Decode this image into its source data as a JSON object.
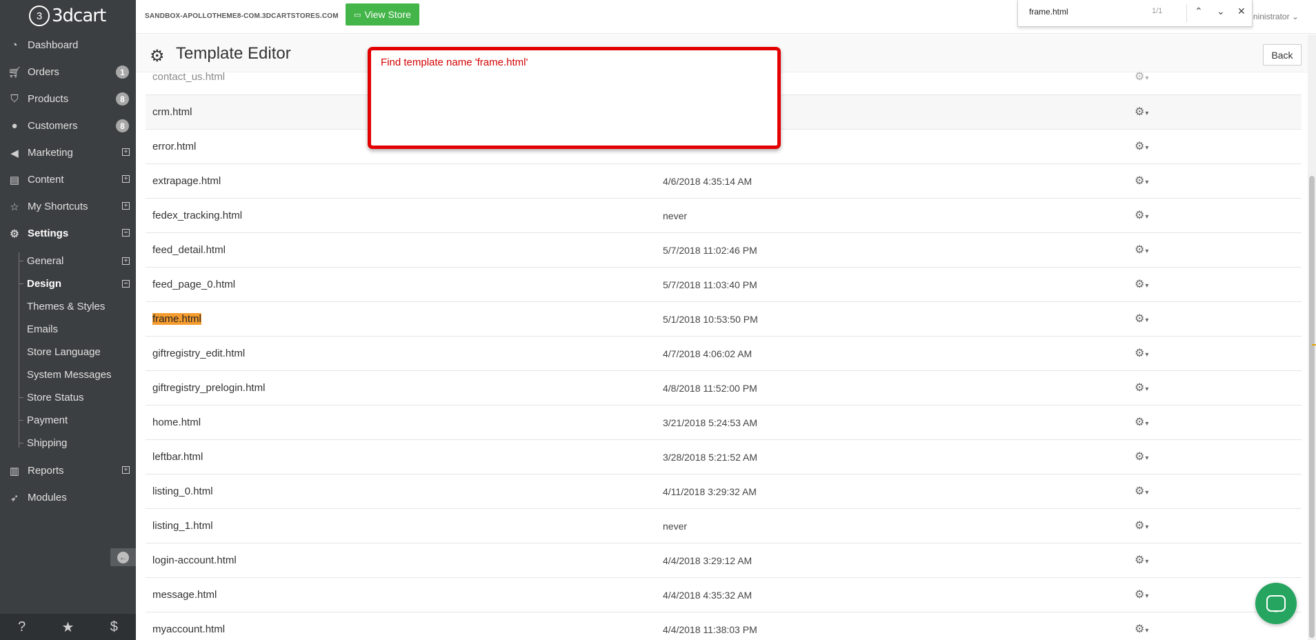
{
  "app": {
    "logo_glyph": "3",
    "logo_text": "3dcart"
  },
  "sidebar": {
    "items": [
      {
        "label": "Dashboard",
        "icon": "dashboard-icon"
      },
      {
        "label": "Orders",
        "icon": "cart-icon",
        "badge": "1"
      },
      {
        "label": "Products",
        "icon": "tags-icon",
        "badge": "8"
      },
      {
        "label": "Customers",
        "icon": "user-icon",
        "badge": "8"
      },
      {
        "label": "Marketing",
        "icon": "megaphone-icon",
        "toggle": "+"
      },
      {
        "label": "Content",
        "icon": "document-icon",
        "toggle": "+"
      },
      {
        "label": "My Shortcuts",
        "icon": "star-icon",
        "toggle": "+"
      },
      {
        "label": "Settings",
        "icon": "gears-icon",
        "toggle": "−"
      }
    ],
    "settings_children": [
      {
        "label": "General",
        "toggle": "+"
      },
      {
        "label": "Design",
        "toggle": "−"
      },
      {
        "label": "Themes & Styles"
      },
      {
        "label": "Emails"
      },
      {
        "label": "Store Language"
      },
      {
        "label": "System Messages"
      },
      {
        "label": "Store Status"
      },
      {
        "label": "Payment"
      },
      {
        "label": "Shipping"
      }
    ],
    "bottom_items": [
      {
        "label": "Reports",
        "icon": "bar-chart-icon",
        "toggle": "+"
      },
      {
        "label": "Modules",
        "icon": "rocket-icon"
      }
    ],
    "footer": {
      "help": "?",
      "favorites": "★",
      "billing": "$"
    }
  },
  "topbar": {
    "store_url": "SANDBOX-APOLLOTHEME8-COM.3DCARTSTORES.COM",
    "view_store_label": "View Store",
    "admin_label": "ninistrator"
  },
  "findbar": {
    "query": "frame.html",
    "count": "1/1"
  },
  "page": {
    "title": "Template Editor",
    "back_label": "Back"
  },
  "templates": [
    {
      "name": "contact_us.html",
      "date": ""
    },
    {
      "name": "crm.html",
      "date": ""
    },
    {
      "name": "error.html",
      "date": ""
    },
    {
      "name": "extrapage.html",
      "date": "4/6/2018 4:35:14 AM"
    },
    {
      "name": "fedex_tracking.html",
      "date": "never"
    },
    {
      "name": "feed_detail.html",
      "date": "5/7/2018 11:02:46 PM"
    },
    {
      "name": "feed_page_0.html",
      "date": "5/7/2018 11:03:40 PM"
    },
    {
      "name": "frame.html",
      "date": "5/1/2018 10:53:50 PM",
      "highlighted": true
    },
    {
      "name": "giftregistry_edit.html",
      "date": "4/7/2018 4:06:02 AM"
    },
    {
      "name": "giftregistry_prelogin.html",
      "date": "4/8/2018 11:52:00 PM"
    },
    {
      "name": "home.html",
      "date": "3/21/2018 5:24:53 AM"
    },
    {
      "name": "leftbar.html",
      "date": "3/28/2018 5:21:52 AM"
    },
    {
      "name": "listing_0.html",
      "date": "4/11/2018 3:29:32 AM"
    },
    {
      "name": "listing_1.html",
      "date": "never"
    },
    {
      "name": "login-account.html",
      "date": "4/4/2018 3:29:12 AM"
    },
    {
      "name": "message.html",
      "date": "4/4/2018 4:35:32 AM"
    },
    {
      "name": "myaccount.html",
      "date": "4/4/2018 11:38:03 PM"
    }
  ],
  "annotation": {
    "text": "Find template name 'frame.html'"
  },
  "colors": {
    "sidebar": "#3c3f41",
    "accent_green": "#43b549",
    "highlight": "#f59c2f",
    "annotation_red": "#e30000",
    "chat_green": "#26a560"
  }
}
